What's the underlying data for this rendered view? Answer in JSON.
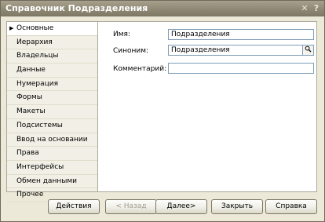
{
  "window": {
    "title": "Справочник Подразделения",
    "close_glyph": "✕",
    "help_glyph": "?"
  },
  "nav": {
    "active_marker": "▶",
    "items": [
      {
        "label": "Основные",
        "active": true
      },
      {
        "label": "Иерархия"
      },
      {
        "label": "Владельцы"
      },
      {
        "label": "Данные"
      },
      {
        "label": "Нумерация"
      },
      {
        "label": "Формы"
      },
      {
        "label": "Макеты"
      },
      {
        "label": "Подсистемы"
      },
      {
        "label": "Ввод на основании"
      },
      {
        "label": "Права"
      },
      {
        "label": "Интерфейсы"
      },
      {
        "label": "Обмен данными"
      },
      {
        "label": "Прочее"
      }
    ]
  },
  "form": {
    "name_label": "Имя:",
    "name_value": "Подразделения",
    "synonym_label": "Синоним:",
    "synonym_value": "Подразделения",
    "synonym_button_icon": "magnifier-icon",
    "comment_label": "Комментарий:",
    "comment_value": ""
  },
  "buttons": {
    "actions": "Действия",
    "back": "< Назад",
    "next": "Далее>",
    "save": "Закрыть",
    "help": "Справка"
  }
}
